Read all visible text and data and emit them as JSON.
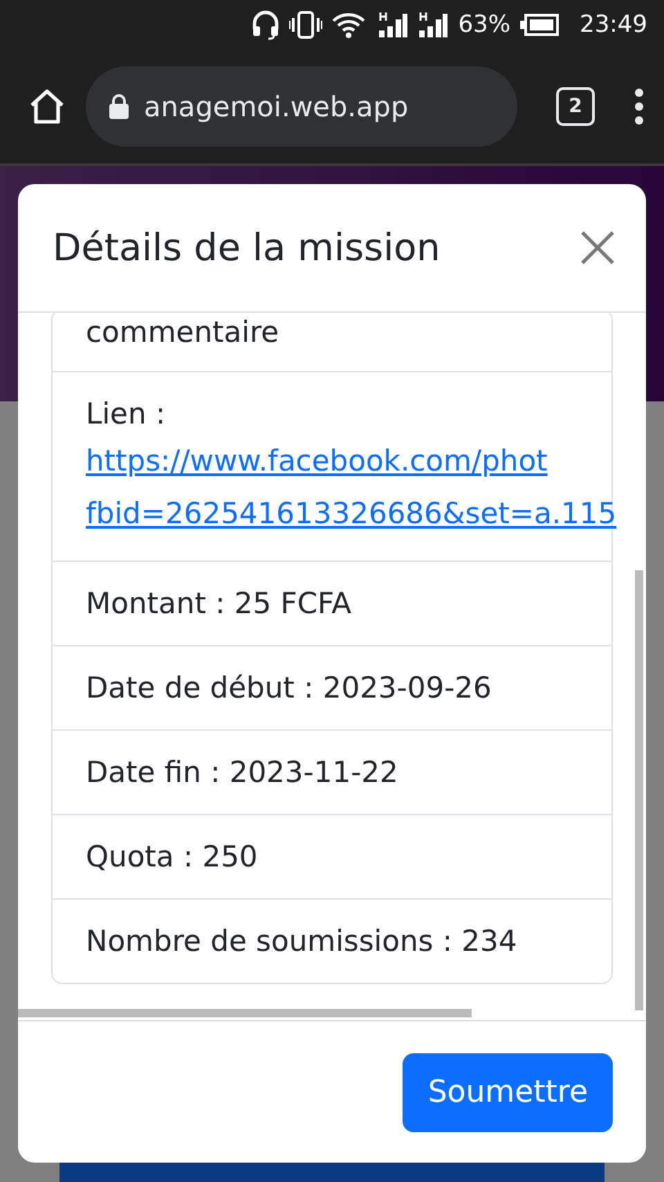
{
  "status_bar": {
    "battery": "63%",
    "time": "23:49"
  },
  "browser": {
    "url": "anagemoi.web.app",
    "tab_count": "2"
  },
  "modal": {
    "title": "Détails de la mission",
    "rows": [
      {
        "kind": "text",
        "text": "commentaire"
      },
      {
        "kind": "link",
        "label": "Lien :",
        "lines": [
          "https://www.facebook.com/phot",
          "fbid=262541613326686&set=a.115"
        ]
      },
      {
        "kind": "text",
        "text": "Montant : 25 FCFA"
      },
      {
        "kind": "text",
        "text": "Date de début : 2023-09-26"
      },
      {
        "kind": "text",
        "text": "Date fin : 2023-11-22"
      },
      {
        "kind": "text",
        "text": "Quota : 250"
      },
      {
        "kind": "text",
        "text": "Nombre de soumissions : 234"
      }
    ],
    "button": "Soumettre"
  }
}
